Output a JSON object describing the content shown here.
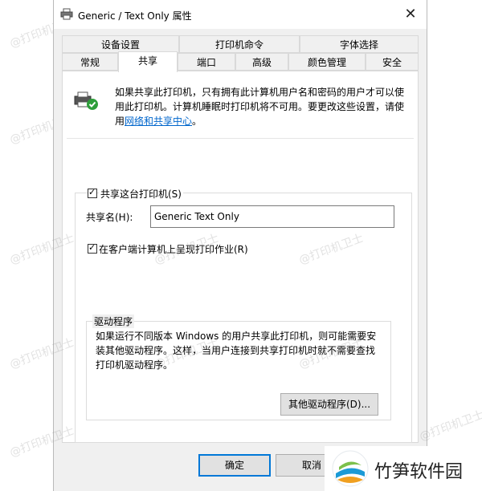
{
  "window": {
    "title": "Generic / Text Only 属性",
    "close_glyph": "✕"
  },
  "tabs_row1": [
    "设备设置",
    "打印机命令",
    "字体选择"
  ],
  "tabs_row2": [
    "常规",
    "共享",
    "端口",
    "高级",
    "颜色管理",
    "安全"
  ],
  "active_tab": "共享",
  "info": {
    "text": "如果共享此打印机，只有拥有此计算机用户名和密码的用户才可以使用此打印机。计算机睡眠时打印机将不可用。要更改这些设置，请使用",
    "link": "网络和共享中心",
    "suffix": "。"
  },
  "share": {
    "checkbox_label": "共享这台打印机(S)",
    "name_label": "共享名(H):",
    "name_value": "Generic  Text Only",
    "render_label": "在客户端计算机上呈现打印作业(R)"
  },
  "drivers": {
    "legend": "驱动程序",
    "text": "如果运行不同版本 Windows 的用户共享此打印机，则可能需要安装其他驱动程序。这样，当用户连接到共享打印机时就不需要查找打印机驱动程序。",
    "button": "其他驱动程序(D)..."
  },
  "buttons": {
    "ok": "确定",
    "cancel": "取消"
  },
  "watermark": "@打印机卫士",
  "brand": {
    "name": "竹笋软件园"
  }
}
